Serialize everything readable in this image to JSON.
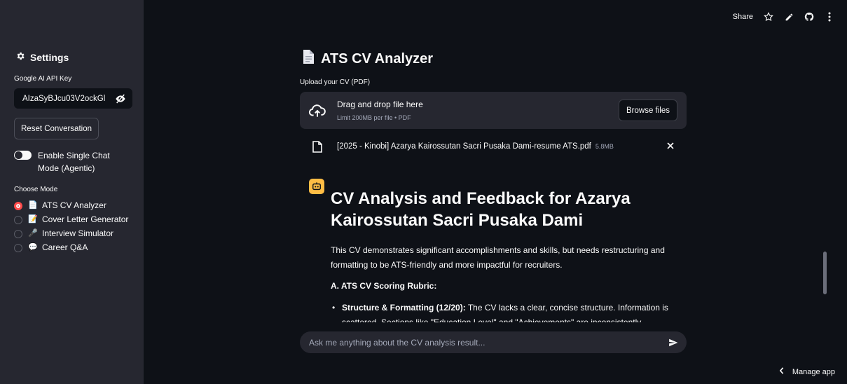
{
  "header": {
    "share_label": "Share",
    "icons": [
      "star-icon",
      "edit-icon",
      "github-icon",
      "more-vert-icon"
    ]
  },
  "sidebar": {
    "title": "Settings",
    "api_key_label": "Google AI API Key",
    "api_key_value": "AIzaSyBJcu03V2ockGl",
    "reset_button": "Reset Conversation",
    "toggle_label": "Enable Single Chat Mode (Agentic)",
    "toggle_on": false,
    "mode_label": "Choose Mode",
    "modes": [
      {
        "emoji": "📄",
        "label": "ATS CV Analyzer",
        "selected": true
      },
      {
        "emoji": "📝",
        "label": "Cover Letter Generator",
        "selected": false
      },
      {
        "emoji": "🎤",
        "label": "Interview Simulator",
        "selected": false
      },
      {
        "emoji": "💬",
        "label": "Career Q&A",
        "selected": false
      }
    ]
  },
  "main": {
    "title": "ATS CV Analyzer",
    "upload_label": "Upload your CV (PDF)",
    "dropzone": {
      "main_text": "Drag and drop file here",
      "sub_text": "Limit 200MB per file • PDF",
      "browse_label": "Browse files"
    },
    "file": {
      "name": "[2025 - Kinobi] Azarya Kairossutan Sacri Pusaka Dami-resume ATS.pdf",
      "size": "5.8MB"
    },
    "message": {
      "heading": "CV Analysis and Feedback for Azarya Kairossutan Sacri Pusaka Dami",
      "intro": "This CV demonstrates significant accomplishments and skills, but needs restructuring and formatting to be ATS-friendly and more impactful for recruiters.",
      "section": "A. ATS CV Scoring Rubric:",
      "bullet_bold": "Structure & Formatting (12/20):",
      "bullet_text": " The CV lacks a clear, concise structure. Information is scattered. Sections like \"Education Level\" and \"Achievements\" are inconsistently formatted."
    },
    "chat_placeholder": "Ask me anything about the CV analysis result..."
  },
  "footer": {
    "manage_app": "Manage app"
  },
  "colors": {
    "background": "#0e1117",
    "sidebar": "#262730",
    "accent": "#ff4b4b",
    "avatar": "#ffbd45"
  }
}
